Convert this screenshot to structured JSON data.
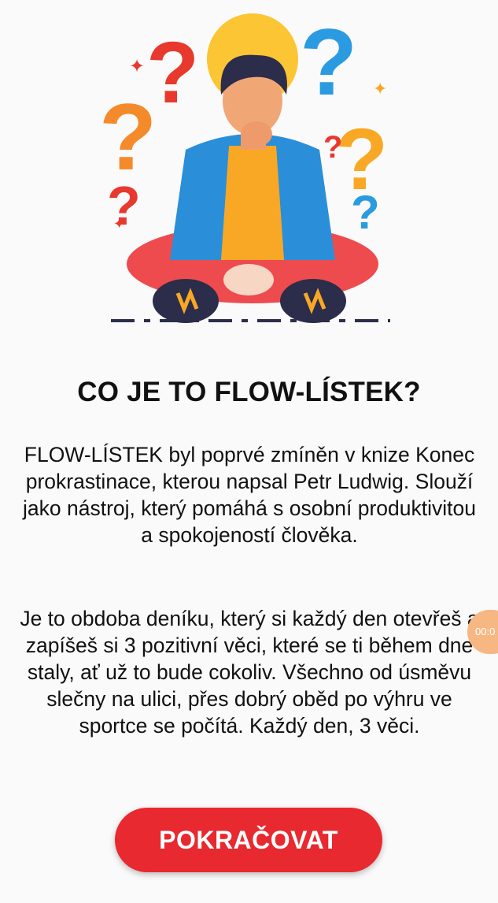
{
  "title": "CO JE TO FLOW-LÍSTEK?",
  "paragraph_1": "FLOW-LÍSTEK byl poprvé zmíněn v knize Konec prokrastinace, kterou napsal Petr Ludwig. Slouží jako nástroj, který pomáhá s osobní produktivitou a spokojeností člověka.",
  "paragraph_2": "Je to obdoba deníku, který si každý den otevřeš a zapíšeš si 3 pozitivní věci, které se ti během dne staly, ať už to bude cokoliv. Všechno od úsměvu slečny na ulici, přes dobrý oběd po výhru ve sportce se počítá. Každý den, 3 věci.",
  "continue_button": "POKRAČOVAT",
  "timer_badge": "00:0",
  "colors": {
    "accent": "#e8292f",
    "background": "#fafafa",
    "badge": "#f7b782"
  },
  "illustration": "thinking-man-with-question-marks"
}
